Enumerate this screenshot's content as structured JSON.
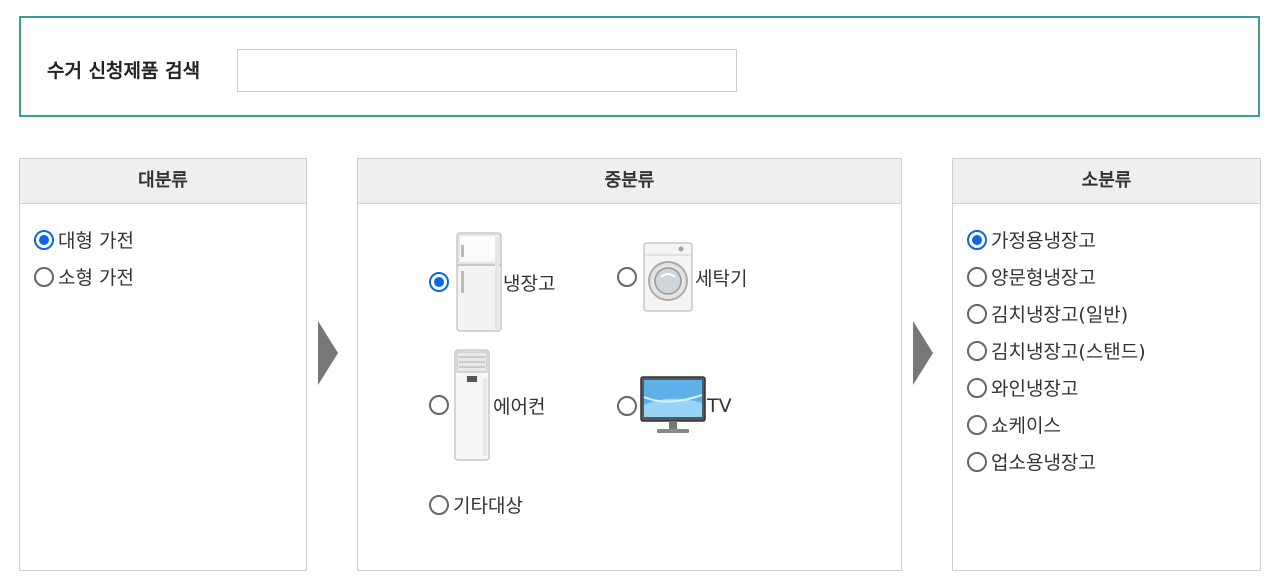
{
  "search": {
    "label": "수거 신청제품 검색",
    "value": "",
    "placeholder": ""
  },
  "major": {
    "title": "대분류",
    "options": [
      {
        "label": "대형 가전",
        "selected": true
      },
      {
        "label": "소형 가전",
        "selected": false
      }
    ]
  },
  "middle": {
    "title": "중분류",
    "options": [
      {
        "label": "냉장고",
        "icon": "refrigerator-icon",
        "selected": true
      },
      {
        "label": "세탁기",
        "icon": "washing-machine-icon",
        "selected": false
      },
      {
        "label": "에어컨",
        "icon": "air-conditioner-icon",
        "selected": false
      },
      {
        "label": "TV",
        "icon": "tv-icon",
        "selected": false
      },
      {
        "label": "기타대상",
        "icon": "",
        "selected": false
      }
    ]
  },
  "minor": {
    "title": "소분류",
    "options": [
      {
        "label": "가정용냉장고",
        "selected": true
      },
      {
        "label": "양문형냉장고",
        "selected": false
      },
      {
        "label": "김치냉장고(일반)",
        "selected": false
      },
      {
        "label": "김치냉장고(스탠드)",
        "selected": false
      },
      {
        "label": "와인냉장고",
        "selected": false
      },
      {
        "label": "쇼케이스",
        "selected": false
      },
      {
        "label": "업소용냉장고",
        "selected": false
      }
    ]
  },
  "colors": {
    "accent": "#3a9d95",
    "radio_selected": "#0b67e8",
    "header_bg": "#efefef"
  }
}
